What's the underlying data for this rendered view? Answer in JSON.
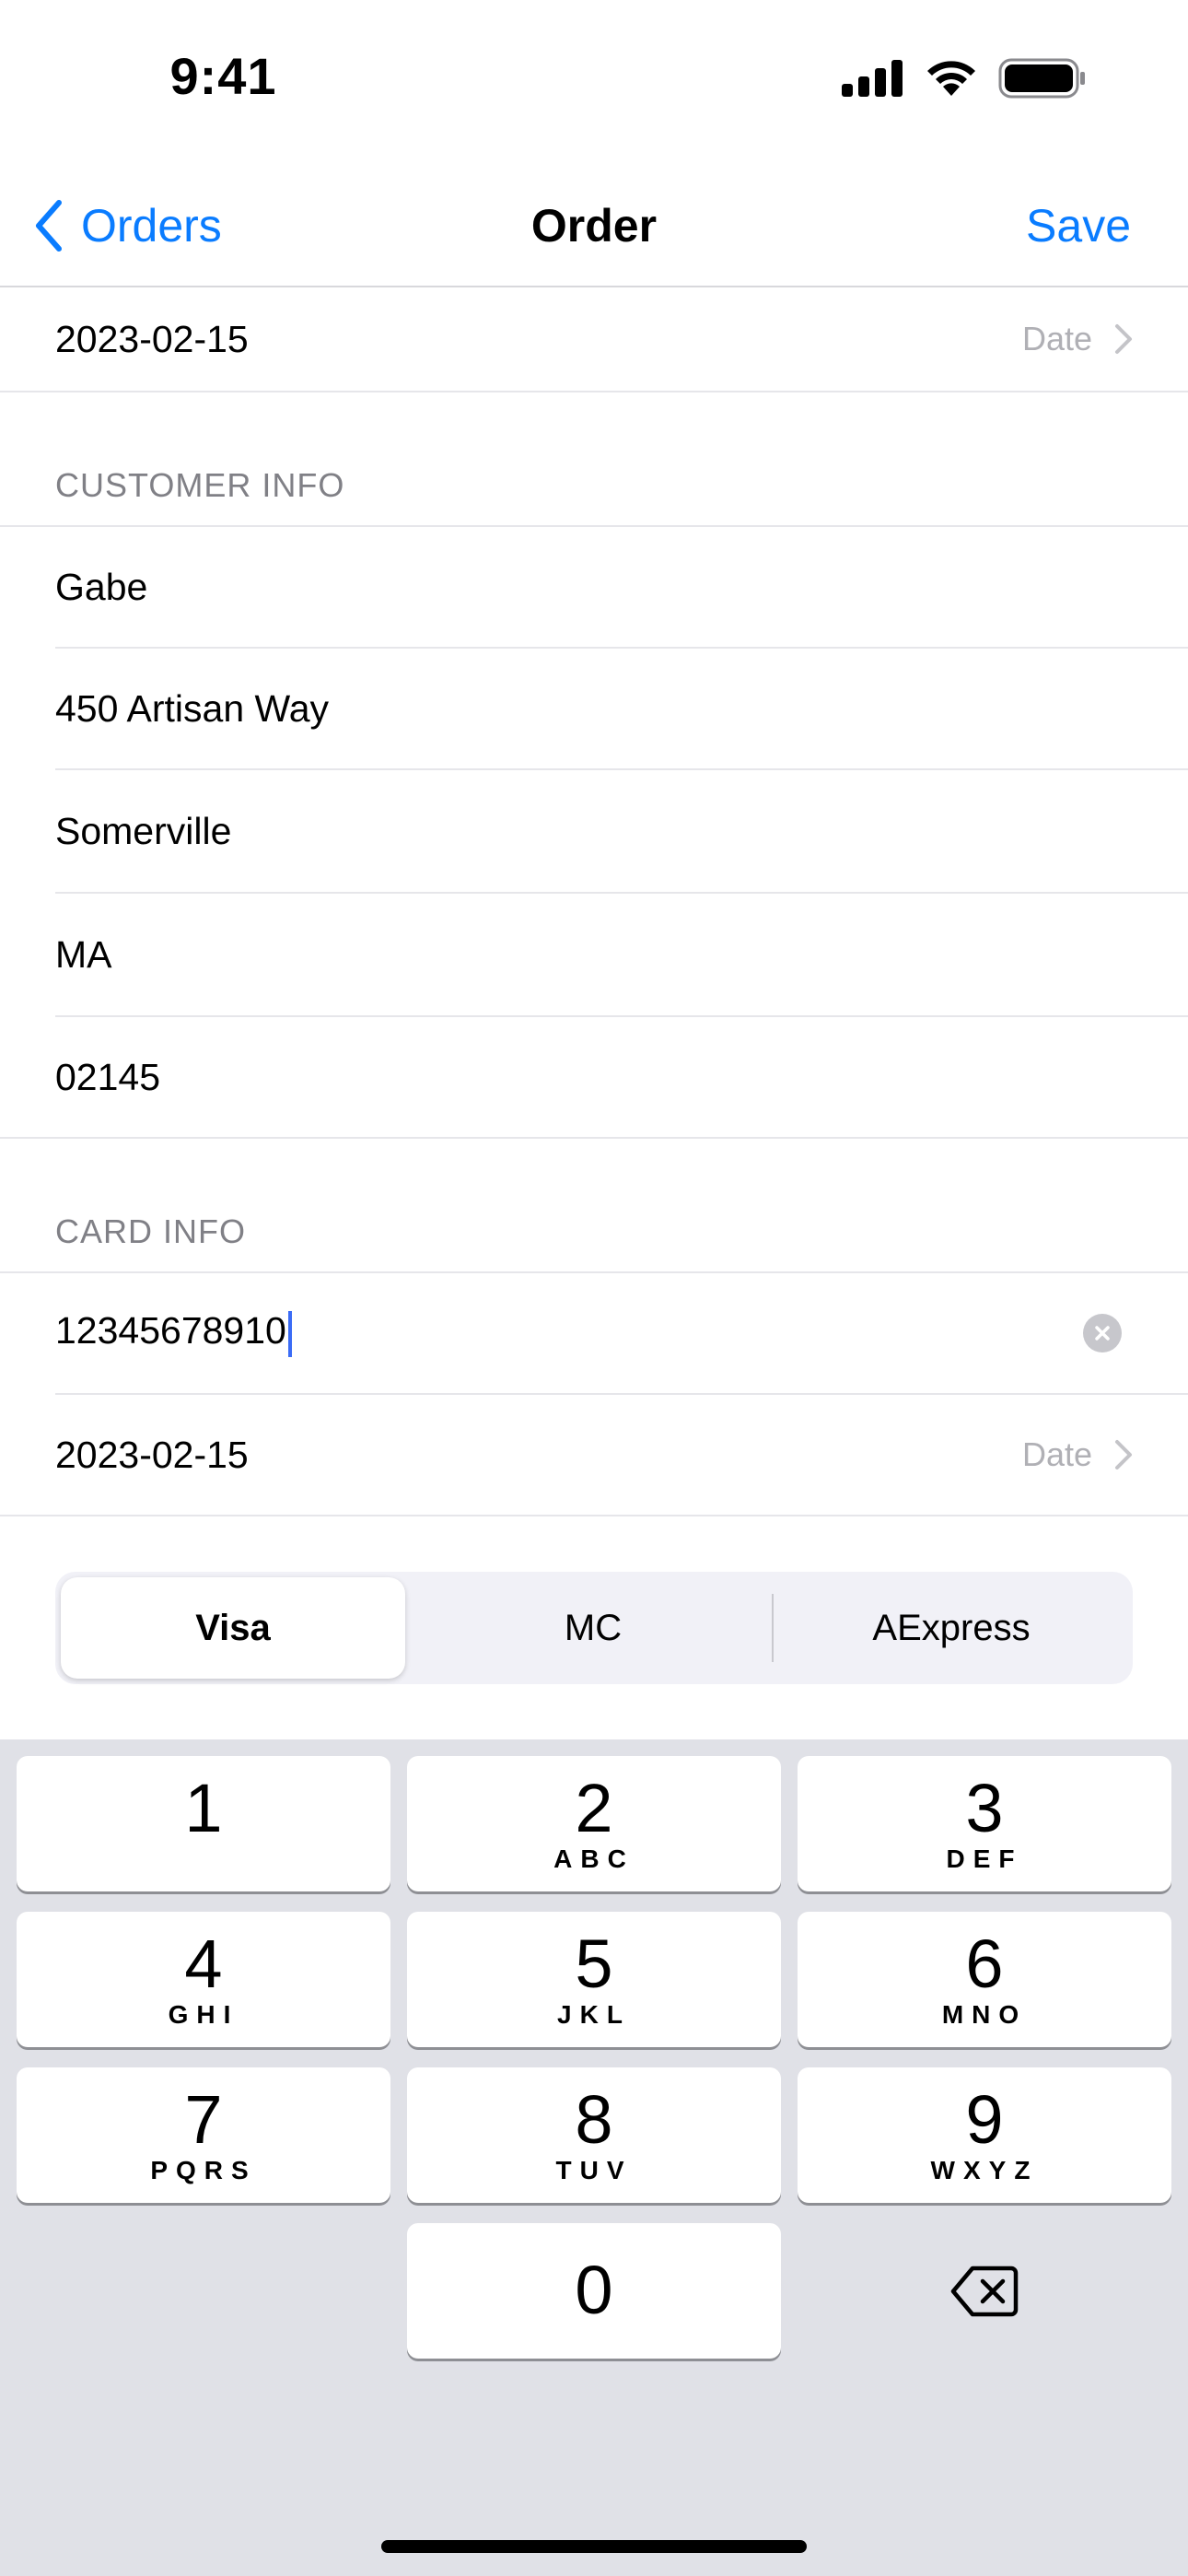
{
  "status_bar": {
    "time": "9:41",
    "icons": [
      "cellular-signal-icon",
      "wifi-icon",
      "battery-icon"
    ]
  },
  "nav": {
    "back_label": "Orders",
    "title": "Order",
    "save_label": "Save",
    "accent_color": "#0a7cff"
  },
  "order_date": {
    "value": "2023-02-15",
    "accessory": "Date"
  },
  "customer_info": {
    "header": "CUSTOMER INFO",
    "fields": [
      "Gabe",
      "450 Artisan Way",
      "Somerville",
      "MA",
      "02145"
    ]
  },
  "card_info": {
    "header": "CARD INFO",
    "card_number": "12345678910",
    "expiry": "2023-02-15",
    "expiry_accessory": "Date"
  },
  "card_type": {
    "options": [
      "Visa",
      "MC",
      "AExpress"
    ],
    "selected": "Visa"
  },
  "keypad": {
    "keys": [
      {
        "digit": "1",
        "letters": ""
      },
      {
        "digit": "2",
        "letters": "ABC"
      },
      {
        "digit": "3",
        "letters": "DEF"
      },
      {
        "digit": "4",
        "letters": "GHI"
      },
      {
        "digit": "5",
        "letters": "JKL"
      },
      {
        "digit": "6",
        "letters": "MNO"
      },
      {
        "digit": "7",
        "letters": "PQRS"
      },
      {
        "digit": "8",
        "letters": "TUV"
      },
      {
        "digit": "9",
        "letters": "WXYZ"
      },
      {
        "digit": "0",
        "letters": ""
      }
    ],
    "delete_icon": "delete-backspace-icon"
  }
}
